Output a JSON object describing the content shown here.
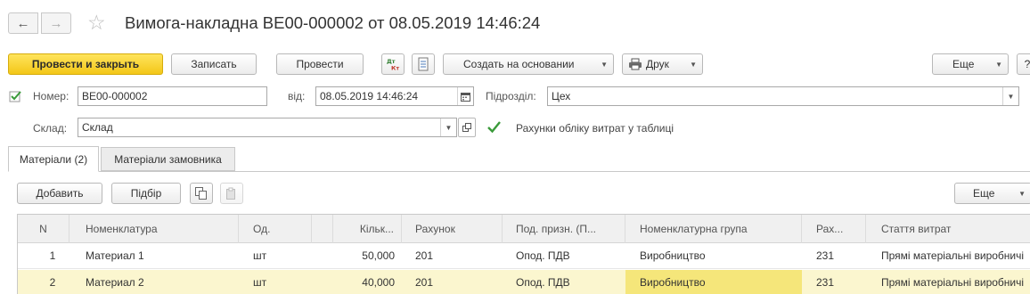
{
  "header": {
    "title": "Вимога-накладна ВЕ00-000002 от 08.05.2019 14:46:24",
    "back_glyph": "←",
    "forward_glyph": "→",
    "star_glyph": "☆"
  },
  "toolbar": {
    "post_close_label": "Провести и закрыть",
    "save_label": "Записать",
    "post_label": "Провести",
    "create_based_label": "Создать на основании",
    "print_label": "Друк",
    "more_label": "Еще",
    "help_label": "?"
  },
  "form": {
    "number_label": "Номер:",
    "number_value": "ВЕ00-000002",
    "date_label": "від:",
    "date_value": "08.05.2019 14:46:24",
    "division_label": "Підрозділ:",
    "division_value": "Цех",
    "warehouse_label": "Склад:",
    "warehouse_value": "Склад",
    "cost_accounts_label": "Рахунки обліку витрат у таблиці",
    "cost_accounts_checked": true
  },
  "tabs": [
    {
      "label": "Матеріали (2)",
      "active": true
    },
    {
      "label": "Матеріали замовника",
      "active": false
    }
  ],
  "table_toolbar": {
    "add_label": "Добавить",
    "select_label": "Підбір",
    "more_label": "Еще"
  },
  "table": {
    "columns": [
      "N",
      "Номенклатура",
      "Од.",
      "",
      "Кільк...",
      "Рахунок",
      "Под. призн. (П...",
      "Номенклатурна група",
      "Рах...",
      "Стаття витрат"
    ],
    "rows": [
      {
        "n": "1",
        "item": "Материал 1",
        "unit": "шт",
        "qty": "50,000",
        "account": "201",
        "tax": "Опод. ПДВ",
        "group": "Виробництво",
        "acc2": "231",
        "cost": "Прямі матеріальні виробничі"
      },
      {
        "n": "2",
        "item": "Материал 2",
        "unit": "шт",
        "qty": "40,000",
        "account": "201",
        "tax": "Опод. ПДВ",
        "group": "Виробництво",
        "acc2": "231",
        "cost": "Прямі матеріальні виробничі"
      }
    ]
  },
  "colors": {
    "primary_button": "#f3c718",
    "selected_row": "#fbf6cf",
    "active_cell": "#f5e67a",
    "checkmark": "#3a9a3a"
  }
}
